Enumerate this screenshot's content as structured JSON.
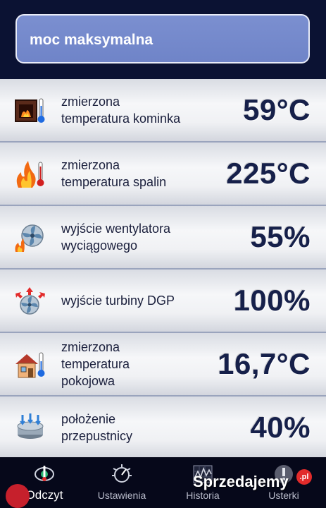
{
  "header": {
    "mode": "moc maksymalna"
  },
  "rows": [
    {
      "label": "zmierzona temperatura kominka",
      "value": "59°C",
      "icon": "fireplace-thermometer-icon"
    },
    {
      "label": "zmierzona temperatura spalin",
      "value": "225°C",
      "icon": "flame-thermometer-icon"
    },
    {
      "label": "wyjście wentylatora wyciągowego",
      "value": "55%",
      "icon": "fan-flame-icon"
    },
    {
      "label": "wyjście turbiny DGP",
      "value": "100%",
      "icon": "turbine-arrows-icon"
    },
    {
      "label": "zmierzona temperatura pokojowa",
      "value": "16,7°C",
      "icon": "house-thermometer-icon"
    },
    {
      "label": "położenie przepustnicy",
      "value": "40%",
      "icon": "damper-icon"
    }
  ],
  "tabs": [
    {
      "label": "Odczyt",
      "icon": "eye-thermometer-icon",
      "active": true
    },
    {
      "label": "Ustawienia",
      "icon": "dial-icon"
    },
    {
      "label": "Historia",
      "icon": "chart-icon"
    },
    {
      "label": "Usterki",
      "icon": "warning-icon"
    }
  ],
  "watermark": {
    "text": "Sprzedajemy",
    "suffix": ".pl"
  },
  "colors": {
    "header_bg": "#0b1233",
    "pill": "#7186c9",
    "value_text": "#16204a",
    "bottom_bg": "#06081a"
  }
}
